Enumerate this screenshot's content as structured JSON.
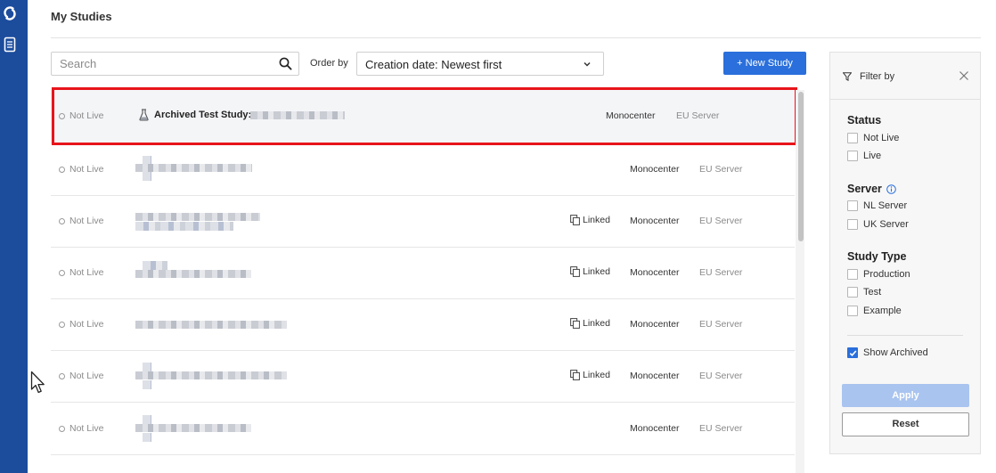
{
  "header": {
    "title": "My Studies"
  },
  "toolbar": {
    "search_placeholder": "Search",
    "order_label": "Order by",
    "order_value": "Creation date: Newest first",
    "new_study_label": "+ New Study"
  },
  "studies": [
    {
      "status": "Not Live",
      "name": "Archived Test Study:",
      "linked": "",
      "center": "Monocenter",
      "server": "EU Server",
      "archived": true
    },
    {
      "status": "Not Live",
      "name": "",
      "linked": "",
      "center": "Monocenter",
      "server": "EU Server",
      "archived": false
    },
    {
      "status": "Not Live",
      "name": "",
      "linked": "Linked",
      "center": "Monocenter",
      "server": "EU Server",
      "archived": false
    },
    {
      "status": "Not Live",
      "name": "",
      "linked": "Linked",
      "center": "Monocenter",
      "server": "EU Server",
      "archived": false
    },
    {
      "status": "Not Live",
      "name": "",
      "linked": "Linked",
      "center": "Monocenter",
      "server": "EU Server",
      "archived": false
    },
    {
      "status": "Not Live",
      "name": "",
      "linked": "Linked",
      "center": "Monocenter",
      "server": "EU Server",
      "archived": false
    },
    {
      "status": "Not Live",
      "name": "",
      "linked": "",
      "center": "Monocenter",
      "server": "EU Server",
      "archived": false
    }
  ],
  "filter": {
    "title": "Filter by",
    "status": {
      "title": "Status",
      "options": [
        {
          "label": "Not Live",
          "checked": false
        },
        {
          "label": "Live",
          "checked": false
        }
      ]
    },
    "server": {
      "title": "Server",
      "options": [
        {
          "label": "NL Server",
          "checked": false
        },
        {
          "label": "UK Server",
          "checked": false
        }
      ]
    },
    "study_type": {
      "title": "Study Type",
      "options": [
        {
          "label": "Production",
          "checked": false
        },
        {
          "label": "Test",
          "checked": false
        },
        {
          "label": "Example",
          "checked": false
        }
      ]
    },
    "show_archived": {
      "label": "Show Archived",
      "checked": true
    },
    "apply_label": "Apply",
    "reset_label": "Reset"
  },
  "colors": {
    "nav": "#1c4c9c",
    "primary": "#2a6fdb",
    "highlight": "#e8141b"
  }
}
